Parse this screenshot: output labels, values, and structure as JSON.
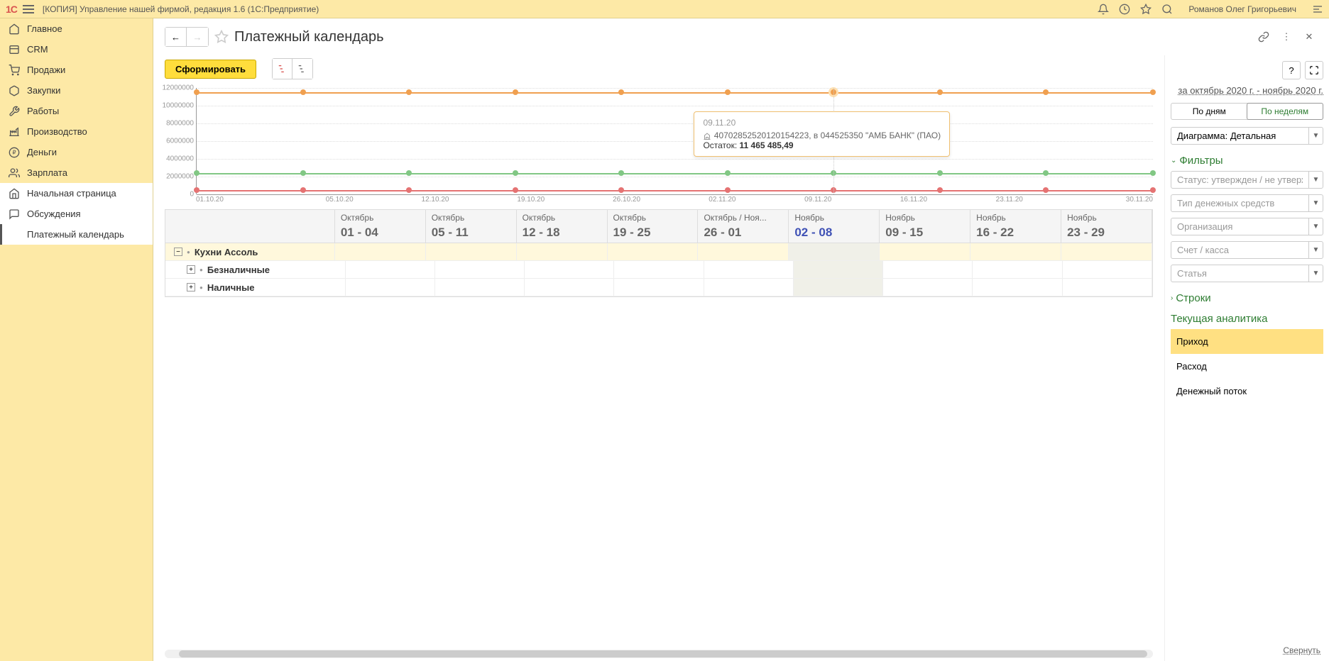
{
  "header": {
    "logo": "1C",
    "title": "[КОПИЯ] Управление нашей фирмой, редакция 1.6  (1С:Предприятие)",
    "user": "Романов Олег Григорьевич"
  },
  "sidebar": {
    "items": [
      {
        "label": "Главное",
        "icon": "home"
      },
      {
        "label": "CRM",
        "icon": "crm"
      },
      {
        "label": "Продажи",
        "icon": "cart"
      },
      {
        "label": "Закупки",
        "icon": "box"
      },
      {
        "label": "Работы",
        "icon": "tools"
      },
      {
        "label": "Производство",
        "icon": "factory"
      },
      {
        "label": "Деньги",
        "icon": "money"
      },
      {
        "label": "Зарплата",
        "icon": "people"
      }
    ],
    "bottom_items": [
      {
        "label": "Начальная страница",
        "icon": "home2"
      },
      {
        "label": "Обсуждения",
        "icon": "chat"
      },
      {
        "label": "Платежный календарь",
        "icon": ""
      }
    ]
  },
  "page": {
    "title": "Платежный календарь",
    "form_btn": "Сформировать"
  },
  "chart_data": {
    "type": "line",
    "y_ticks": [
      "0",
      "2000000",
      "4000000",
      "6000000",
      "8000000",
      "10000000",
      "12000000"
    ],
    "x_ticks": [
      "01.10.20",
      "05.10.20",
      "12.10.20",
      "19.10.20",
      "26.10.20",
      "02.11.20",
      "09.11.20",
      "16.11.20",
      "23.11.20",
      "30.11.20"
    ],
    "series": [
      {
        "name": "orange",
        "color": "#f0a050",
        "value": 11465485,
        "y_pct": 4
      },
      {
        "name": "green",
        "color": "#81c784",
        "value": 2300000,
        "y_pct": 80
      },
      {
        "name": "pink",
        "color": "#e57373",
        "value": 300000,
        "y_pct": 96
      }
    ],
    "tooltip": {
      "date": "09.11.20",
      "account": "40702852520120154223, в 044525350 \"АМБ БАНК\" (ПАО)",
      "balance_label": "Остаток:",
      "balance_value": "11 465 485,49"
    }
  },
  "table": {
    "columns": [
      {
        "month": "Октябрь",
        "days": "01 - 04"
      },
      {
        "month": "Октябрь",
        "days": "05 - 11"
      },
      {
        "month": "Октябрь",
        "days": "12 - 18"
      },
      {
        "month": "Октябрь",
        "days": "19 - 25"
      },
      {
        "month": "Октябрь / Ноя...",
        "days": "26 - 01"
      },
      {
        "month": "Ноябрь",
        "days": "02 - 08",
        "current": true
      },
      {
        "month": "Ноябрь",
        "days": "09 - 15"
      },
      {
        "month": "Ноябрь",
        "days": "16 - 22"
      },
      {
        "month": "Ноябрь",
        "days": "23 - 29"
      }
    ],
    "rows": [
      {
        "label": "Кухни Ассоль",
        "expanded": true,
        "bold": true,
        "highlight": true,
        "indent": 0
      },
      {
        "label": "Безналичные",
        "expanded": false,
        "bold": true,
        "indent": 1
      },
      {
        "label": "Наличные",
        "expanded": false,
        "bold": true,
        "indent": 1
      }
    ]
  },
  "right_panel": {
    "date_range": "за октябрь 2020 г. - ноябрь 2020 г.",
    "toggle": {
      "by_days": "По дням",
      "by_weeks": "По неделям"
    },
    "diagram_value": "Диаграмма: Детальная",
    "filters_label": "Фильтры",
    "filter_placeholders": {
      "status": "Статус: утвержден / не утвержден",
      "cash_type": "Тип денежных средств",
      "org": "Организация",
      "account": "Счет / касса",
      "article": "Статья"
    },
    "rows_label": "Строки",
    "analytics_label": "Текущая аналитика",
    "analytics_items": [
      "Приход",
      "Расход",
      "Денежный поток"
    ],
    "collapse": "Свернуть",
    "help": "?"
  }
}
